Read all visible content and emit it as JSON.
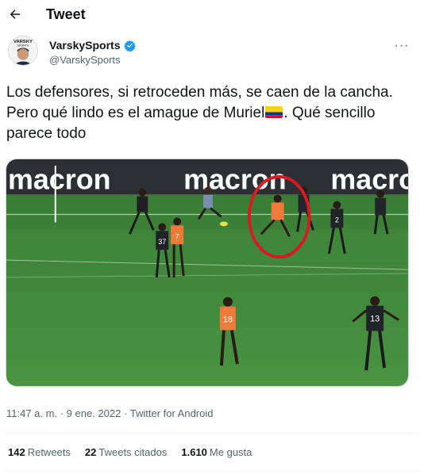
{
  "header": {
    "title": "Tweet"
  },
  "author": {
    "name": "VarskySports",
    "handle": "@VarskySports",
    "avatar_label": "VARSKY SPORTS"
  },
  "tweet": {
    "text_before_flag": "Los defensores, si retroceden más, se caen de la cancha. Pero qué lindo es el amague de Muriel",
    "text_after_flag": ". Qué sencillo parece todo",
    "flag_icon": "colombia-flag-icon"
  },
  "media": {
    "banner_word": "macron",
    "banner_word_partial": "macro",
    "jersey_numbers": [
      "37",
      "7",
      "2",
      "18",
      "13"
    ]
  },
  "meta": {
    "time": "11:47 a. m.",
    "separator_1": "·",
    "date": "9 ene. 2022",
    "separator_2": "·",
    "source": "Twitter for Android"
  },
  "stats": {
    "retweets": {
      "count": "142",
      "label": "Retweets"
    },
    "quotes": {
      "count": "22",
      "label": "Tweets citados"
    },
    "likes": {
      "count": "1.610",
      "label": "Me gusta"
    }
  },
  "colors": {
    "text": "#0f1419",
    "secondary": "#536471",
    "verified": "#1d9bf0",
    "pitch": "#3f8a3c",
    "highlight_circle": "#d81b20"
  }
}
